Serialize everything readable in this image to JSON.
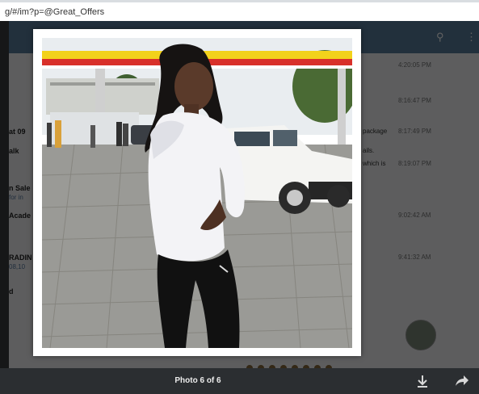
{
  "browser": {
    "url": "g/#/im?p=@Great_Offers"
  },
  "app": {
    "header_icons": [
      "search-icon",
      "more-icon"
    ],
    "chat_rows": [
      {
        "label": "",
        "sub": "",
        "time": "4:20:05 PM",
        "msg": ""
      },
      {
        "label": "",
        "sub": "",
        "time": "8:16:47 PM",
        "msg": ""
      },
      {
        "label": "at 09",
        "sub": "",
        "time": "8:17:49 PM",
        "msg": "package"
      },
      {
        "label": "alk",
        "sub": "",
        "time": "",
        "msg": "ails."
      },
      {
        "label": "",
        "sub": "",
        "time": "8:19:07 PM",
        "msg": "which is"
      },
      {
        "label": "n Sale",
        "sub": "for in",
        "time": "",
        "msg": ""
      },
      {
        "label": "Acade",
        "sub": "",
        "time": "9:02:42 AM",
        "msg": ""
      },
      {
        "label": "RADIN",
        "sub": "08,10",
        "time": "9:41:32 AM",
        "msg": ""
      },
      {
        "label": "d",
        "sub": "",
        "time": "",
        "msg": ""
      }
    ]
  },
  "viewer": {
    "counter": "Photo 6 of 6",
    "download_icon": "download-icon",
    "share_icon": "share-icon"
  },
  "colors": {
    "header": "#5b7f9e",
    "bottom_bar": "#2b2e31",
    "canopy_yellow": "#f2d21b",
    "canopy_red": "#d8302a"
  }
}
